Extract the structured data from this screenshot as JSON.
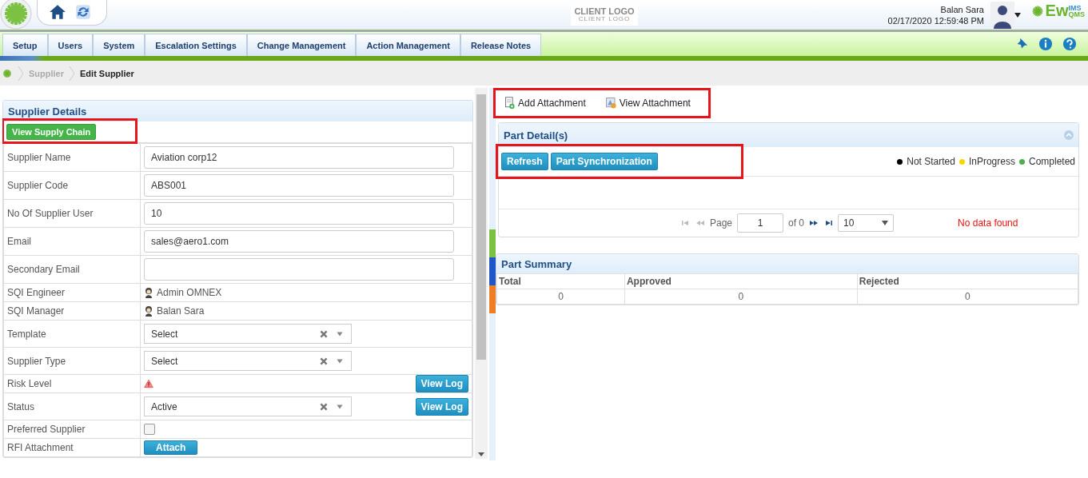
{
  "header": {
    "client_logo": "CLIENT LOGO",
    "client_logo_sub": "CLIENT LOGO",
    "user_name": "Balan Sara",
    "datetime": "02/17/2020 12:59:48 PM",
    "brand": "Ew",
    "brand_sup": "IMS",
    "brand_sub": "QMS"
  },
  "nav": {
    "tabs": [
      {
        "label": "Setup",
        "selected": false
      },
      {
        "label": "Users",
        "selected": false
      },
      {
        "label": "System",
        "selected": false
      },
      {
        "label": "Escalation Settings",
        "selected": false
      },
      {
        "label": "Change Management",
        "selected": false
      },
      {
        "label": "Action Management",
        "selected": false
      },
      {
        "label": "Release Notes",
        "selected": false
      }
    ]
  },
  "breadcrumb": [
    "Supplier",
    "Edit Supplier"
  ],
  "supplier_details": {
    "title": "Supplier Details",
    "highlighted": true,
    "button": "View Supply Chain",
    "rows": [
      {
        "kind": "input",
        "label": "Supplier Name",
        "value": "Aviation corp12"
      },
      {
        "kind": "input",
        "label": "Supplier Code",
        "value": "ABS001"
      },
      {
        "kind": "input",
        "label": "No Of Supplier User",
        "value": "10"
      },
      {
        "kind": "input",
        "label": "Email",
        "value": "sales@aero1.com"
      },
      {
        "kind": "input",
        "label": "Secondary Email"
      },
      {
        "kind": "person",
        "label": "SQI Engineer",
        "value": "Admin OMNEX"
      },
      {
        "kind": "person",
        "label": "SQI Manager",
        "value": "Balan Sara"
      },
      {
        "kind": "select",
        "label": "Template",
        "value": "Select"
      },
      {
        "kind": "select",
        "label": "Supplier Type",
        "value": "Select"
      },
      {
        "kind": "risk",
        "label": "Risk Level",
        "log_button": "View Log"
      },
      {
        "kind": "select",
        "label": "Status",
        "value": "Active",
        "log_button": "View Log"
      },
      {
        "kind": "checkbox",
        "label": "Preferred Supplier",
        "checked": false
      },
      {
        "kind": "attach",
        "label": "RFI Attachment",
        "button": "Attach"
      }
    ]
  },
  "attachments": {
    "highlighted": true,
    "items": [
      "Add Attachment",
      "View Attachment"
    ]
  },
  "part_details": {
    "title": "Part Detail(s)",
    "highlighted": true,
    "buttons": [
      "Refresh",
      "Part Synchronization"
    ],
    "legend": [
      {
        "label": "Not Started",
        "color": "#000000"
      },
      {
        "label": "InProgress",
        "color": "#f5d800"
      },
      {
        "label": "Completed",
        "color": "#4caf50"
      }
    ],
    "pager": {
      "page_label": "Page",
      "page": "1",
      "of": "of 0",
      "page_size": "10"
    },
    "message": "No data found"
  },
  "part_summary": {
    "title": "Part Summary",
    "columns": [
      "Total",
      "Approved",
      "Rejected"
    ],
    "rows": [
      [
        "0",
        "0",
        "0"
      ]
    ]
  }
}
